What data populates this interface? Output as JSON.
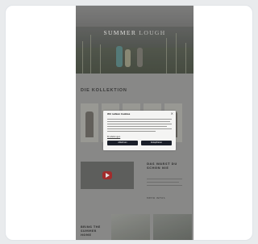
{
  "hero": {
    "title_part1": "SUMMER",
    "title_part2": "LOUGH"
  },
  "collection": {
    "title": "DIE KOLLEKTION"
  },
  "promo": {
    "heading": "DAS WARST DU SCHON NIE",
    "link_label": "MEHR INFOS"
  },
  "bottom": {
    "text": "BRING THE SUMMER HOME"
  },
  "cookie": {
    "title": "Wir nutzen Cookies",
    "settings_label": "Einstellungen",
    "decline_label": "Ablehnen",
    "accept_label": "Akzeptieren"
  },
  "colors": {
    "page_bg": "#e9ebed",
    "phone_bg": "#8a8a89",
    "cookie_button": "#1a1f2a",
    "play_button": "#a82222"
  }
}
